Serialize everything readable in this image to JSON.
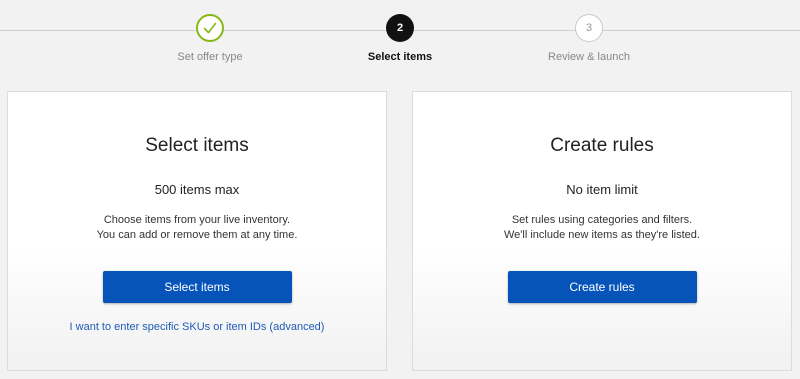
{
  "stepper": {
    "steps": [
      {
        "number": "",
        "label": "Set offer type",
        "state": "complete",
        "icon": "check-icon"
      },
      {
        "number": "2",
        "label": "Select items",
        "state": "current"
      },
      {
        "number": "3",
        "label": "Review & launch",
        "state": "upcoming"
      }
    ]
  },
  "cards": [
    {
      "title": "Select items",
      "limit": "500 items max",
      "desc_line1": "Choose items from your live inventory.",
      "desc_line2": "You can add or remove them at any time.",
      "button": "Select items",
      "link": "I want to enter specific SKUs or item IDs (advanced)"
    },
    {
      "title": "Create rules",
      "limit": "No item limit",
      "desc_line1": "Set rules using categories and filters.",
      "desc_line2": "We'll include new items as they're listed.",
      "button": "Create rules"
    }
  ],
  "colors": {
    "primary_button": "#0654ba",
    "link": "#1e5bb8",
    "complete_check": "#86b817",
    "current_step": "#111111"
  }
}
